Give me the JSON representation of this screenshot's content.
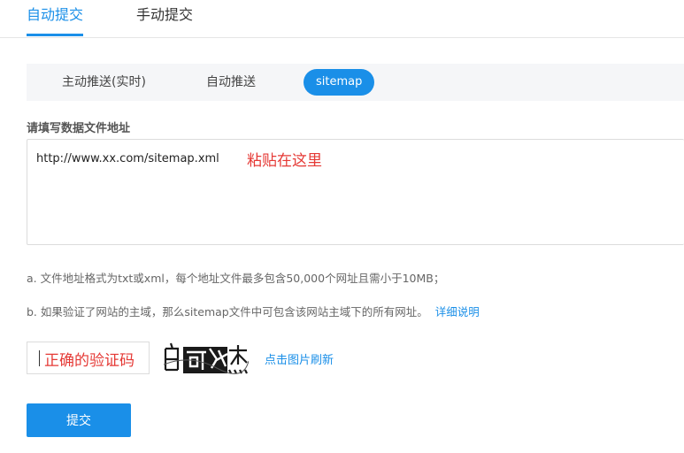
{
  "tabs": [
    {
      "label": "自动提交",
      "active": true
    },
    {
      "label": "手动提交",
      "active": false
    }
  ],
  "subtabs": [
    {
      "label": "主动推送(实时)",
      "active": false
    },
    {
      "label": "自动推送",
      "active": false
    },
    {
      "label": "sitemap",
      "active": true
    }
  ],
  "form": {
    "label": "请填写数据文件地址",
    "url_value": "http://www.xx.com/sitemap.xml",
    "paste_hint": "粘贴在这里"
  },
  "notes": {
    "a": "a. 文件地址格式为txt或xml，每个地址文件最多包含50,000个网址且需小于10MB；",
    "b": "b. 如果验证了网站的主域，那么sitemap文件中可包含该网站主域下的所有网址。",
    "b_link": "详细说明"
  },
  "captcha": {
    "input_value": "正确的验证码",
    "image_text": "白可效杰",
    "refresh_label": "点击图片刷新"
  },
  "submit_label": "提交",
  "colors": {
    "accent": "#1a8fe8",
    "hint_red": "#e53935"
  }
}
